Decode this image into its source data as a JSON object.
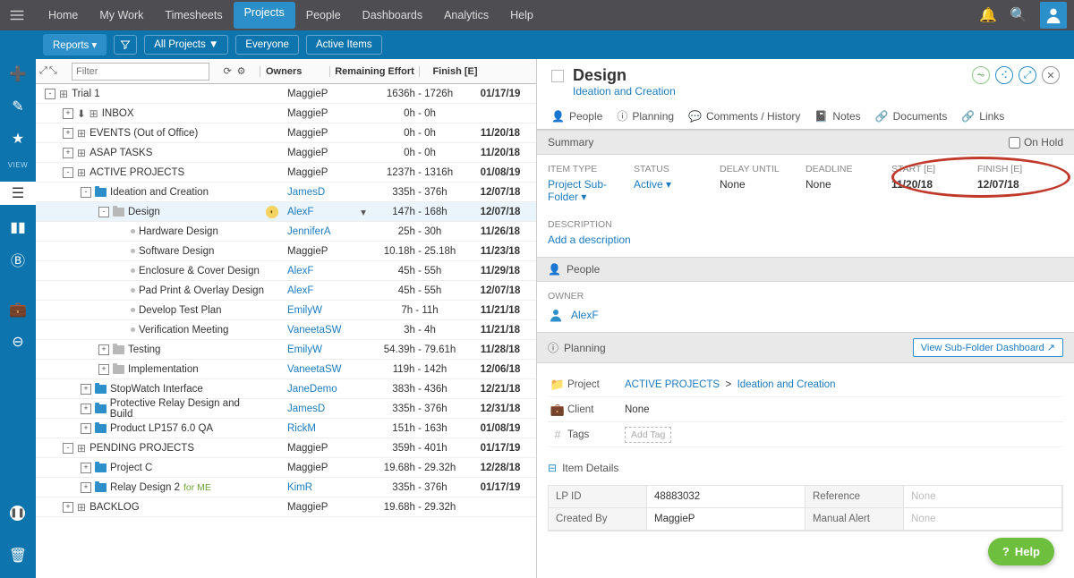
{
  "topnav": {
    "items": [
      "Home",
      "My Work",
      "Timesheets",
      "Projects",
      "People",
      "Dashboards",
      "Analytics",
      "Help"
    ],
    "active": "Projects"
  },
  "bluebar": {
    "reports": "Reports ▾",
    "all_projects": "All Projects ▼",
    "everyone": "Everyone",
    "active_items": "Active Items"
  },
  "leftrail": {
    "view": "VIEW"
  },
  "cols": {
    "owners": "Owners",
    "effort": "Remaining Effort",
    "finish": "Finish [E]"
  },
  "filter": {
    "placeholder": "Filter"
  },
  "rows": [
    {
      "depth": 0,
      "tog": "-",
      "icon": "cube",
      "label": "Trial 1",
      "owner": "MaggieP",
      "olink": false,
      "eff": "1636h - 1726h",
      "fin": "01/17/19"
    },
    {
      "depth": 1,
      "tog": "+",
      "dl": true,
      "icon": "cube",
      "label": "INBOX",
      "owner": "MaggieP",
      "olink": false,
      "eff": "0h - 0h",
      "fin": ""
    },
    {
      "depth": 1,
      "tog": "+",
      "icon": "cube",
      "label": "EVENTS (Out of Office)",
      "owner": "MaggieP",
      "olink": false,
      "eff": "0h - 0h",
      "fin": "11/20/18"
    },
    {
      "depth": 1,
      "tog": "+",
      "icon": "cube",
      "label": "ASAP TASKS",
      "owner": "MaggieP",
      "olink": false,
      "eff": "0h - 0h",
      "fin": "11/20/18"
    },
    {
      "depth": 1,
      "tog": "-",
      "icon": "cube",
      "label": "ACTIVE PROJECTS",
      "owner": "MaggieP",
      "olink": false,
      "eff": "1237h - 1316h",
      "fin": "01/08/19"
    },
    {
      "depth": 2,
      "tog": "-",
      "icon": "fld",
      "label": "Ideation and Creation",
      "owner": "JamesD",
      "olink": true,
      "eff": "335h - 376h",
      "fin": "12/07/18"
    },
    {
      "depth": 3,
      "tog": "-",
      "icon": "fldg",
      "label": "Design",
      "owner": "AlexF",
      "olink": true,
      "car": true,
      "eff": "147h - 168h",
      "fin": "12/07/18",
      "hl": true,
      "badge": true
    },
    {
      "depth": 4,
      "tog": "",
      "icon": "dot",
      "label": "Hardware Design",
      "owner": "JenniferA",
      "olink": true,
      "eff": "25h - 30h",
      "fin": "11/26/18"
    },
    {
      "depth": 4,
      "tog": "",
      "icon": "dot",
      "label": "Software Design",
      "owner": "MaggieP",
      "olink": false,
      "eff": "10.18h - 25.18h",
      "fin": "11/23/18"
    },
    {
      "depth": 4,
      "tog": "",
      "icon": "dot",
      "label": "Enclosure & Cover Design",
      "owner": "AlexF",
      "olink": true,
      "eff": "45h - 55h",
      "fin": "11/29/18"
    },
    {
      "depth": 4,
      "tog": "",
      "icon": "dot",
      "label": "Pad Print & Overlay Design",
      "owner": "AlexF",
      "olink": true,
      "eff": "45h - 55h",
      "fin": "12/07/18"
    },
    {
      "depth": 4,
      "tog": "",
      "icon": "dot",
      "label": "Develop Test Plan",
      "owner": "EmilyW",
      "olink": true,
      "eff": "7h - 11h",
      "fin": "11/21/18"
    },
    {
      "depth": 4,
      "tog": "",
      "icon": "dot",
      "label": "Verification Meeting",
      "owner": "VaneetaSW",
      "olink": true,
      "eff": "3h - 4h",
      "fin": "11/21/18"
    },
    {
      "depth": 3,
      "tog": "+",
      "icon": "fldg",
      "label": "Testing",
      "owner": "EmilyW",
      "olink": true,
      "eff": "54.39h - 79.61h",
      "fin": "11/28/18"
    },
    {
      "depth": 3,
      "tog": "+",
      "icon": "fldg",
      "label": "Implementation",
      "owner": "VaneetaSW",
      "olink": true,
      "eff": "119h - 142h",
      "fin": "12/06/18"
    },
    {
      "depth": 2,
      "tog": "+",
      "icon": "fld",
      "label": "StopWatch Interface",
      "owner": "JaneDemo",
      "olink": true,
      "eff": "383h - 436h",
      "fin": "12/21/18"
    },
    {
      "depth": 2,
      "tog": "+",
      "icon": "fld",
      "label": "Protective Relay Design and Build",
      "owner": "JamesD",
      "olink": true,
      "eff": "335h - 376h",
      "fin": "12/31/18"
    },
    {
      "depth": 2,
      "tog": "+",
      "icon": "fld",
      "label": "Product LP157 6.0 QA",
      "owner": "RickM",
      "olink": true,
      "eff": "151h - 163h",
      "fin": "01/08/19"
    },
    {
      "depth": 1,
      "tog": "-",
      "icon": "cube",
      "label": "PENDING PROJECTS",
      "owner": "MaggieP",
      "olink": false,
      "eff": "359h - 401h",
      "fin": "01/17/19"
    },
    {
      "depth": 2,
      "tog": "+",
      "icon": "fld",
      "label": "Project C",
      "owner": "MaggieP",
      "olink": false,
      "eff": "19.68h - 29.32h",
      "fin": "12/28/18"
    },
    {
      "depth": 2,
      "tog": "+",
      "icon": "fld",
      "label": "Relay Design 2",
      "tag": "for ME",
      "owner": "KimR",
      "olink": true,
      "eff": "335h - 376h",
      "fin": "01/17/19"
    },
    {
      "depth": 1,
      "tog": "+",
      "icon": "cube",
      "label": "BACKLOG",
      "owner": "MaggieP",
      "olink": false,
      "eff": "19.68h - 29.32h",
      "fin": ""
    }
  ],
  "detail": {
    "title": "Design",
    "sub": "Ideation and Creation",
    "tabs": [
      "People",
      "Planning",
      "Comments / History",
      "Notes",
      "Documents",
      "Links"
    ],
    "sec_summary": "Summary",
    "on_hold": "On Hold",
    "sum": [
      {
        "lbl": "ITEM TYPE",
        "val": "Project Sub-Folder ▾",
        "link": true
      },
      {
        "lbl": "STATUS",
        "val": "Active ▾",
        "link": true
      },
      {
        "lbl": "DELAY UNTIL",
        "val": "None"
      },
      {
        "lbl": "DEADLINE",
        "val": "None"
      },
      {
        "lbl": "START [E]",
        "val": "11/20/18",
        "bold": true
      },
      {
        "lbl": "FINISH [E]",
        "val": "12/07/18",
        "bold": true
      }
    ],
    "desc_label": "DESCRIPTION",
    "desc_link": "Add a description",
    "sec_people": "People",
    "owner_lbl": "OWNER",
    "owner": "AlexF",
    "sec_planning": "Planning",
    "view_dash": "View Sub-Folder Dashboard ↗",
    "plan": [
      {
        "ico": "📁",
        "lbl": "Project",
        "html": "<a>ACTIVE PROJECTS</a> &nbsp;>&nbsp; <a>Ideation and Creation</a>"
      },
      {
        "ico": "💼",
        "lbl": "Client",
        "html": "None"
      },
      {
        "ico": "#",
        "lbl": "Tags",
        "html": "<span class='tagbox'>Add Tag</span>"
      }
    ],
    "sec_details": "Item Details",
    "grid": [
      [
        "LP ID",
        "48883032",
        "Reference",
        "None"
      ],
      [
        "Created By",
        "MaggieP",
        "Manual Alert",
        "None"
      ]
    ]
  },
  "help": "Help"
}
